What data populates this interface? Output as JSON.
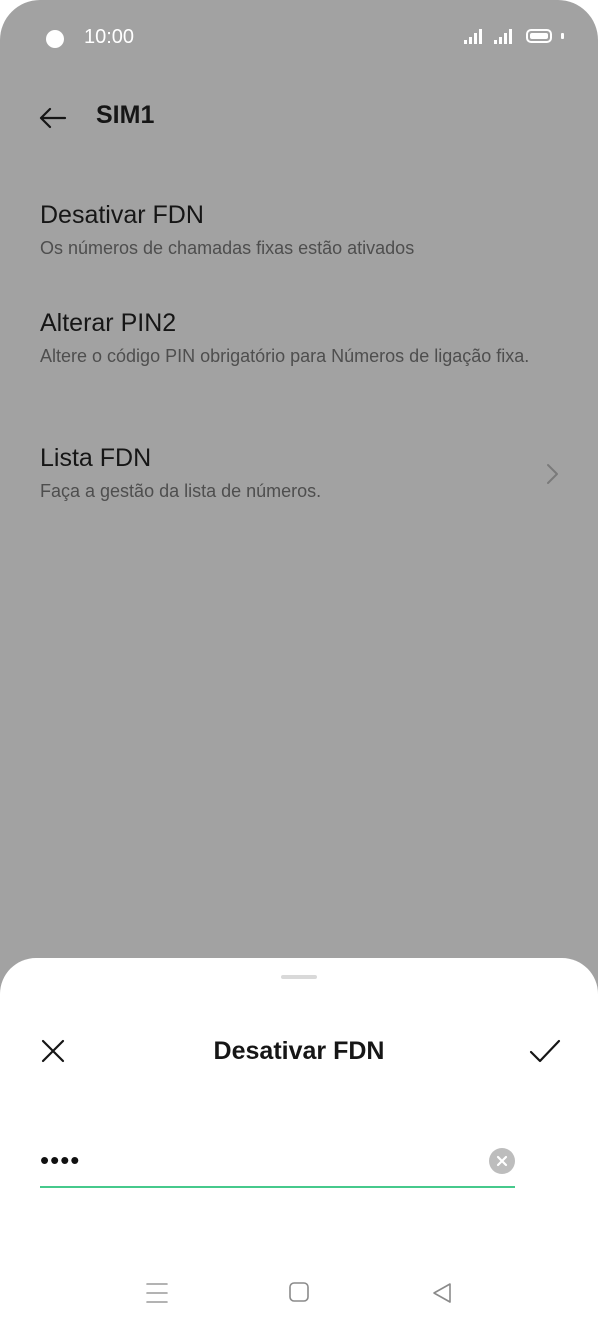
{
  "status_bar": {
    "time": "10:00"
  },
  "header": {
    "title": "SIM1"
  },
  "settings": [
    {
      "title": "Desativar FDN",
      "subtitle": "Os números de chamadas fixas estão ativados"
    },
    {
      "title": "Alterar PIN2",
      "subtitle": "Altere o código PIN obrigatório para Números de ligação fixa."
    },
    {
      "title": "Lista FDN",
      "subtitle": "Faça a gestão da lista de números."
    }
  ],
  "sheet": {
    "title": "Desativar FDN",
    "pin_value": "••••"
  },
  "colors": {
    "background_dim": "#a2a2a2",
    "accent": "#46c98c",
    "text_primary": "#161616"
  },
  "icons": {
    "back": "arrow-left-icon",
    "chevron": "chevron-right-icon",
    "close": "close-icon",
    "confirm": "check-icon",
    "clear": "clear-input-icon",
    "nav_menu": "menu-icon",
    "nav_home": "home-square-icon",
    "nav_back": "back-triangle-icon"
  }
}
